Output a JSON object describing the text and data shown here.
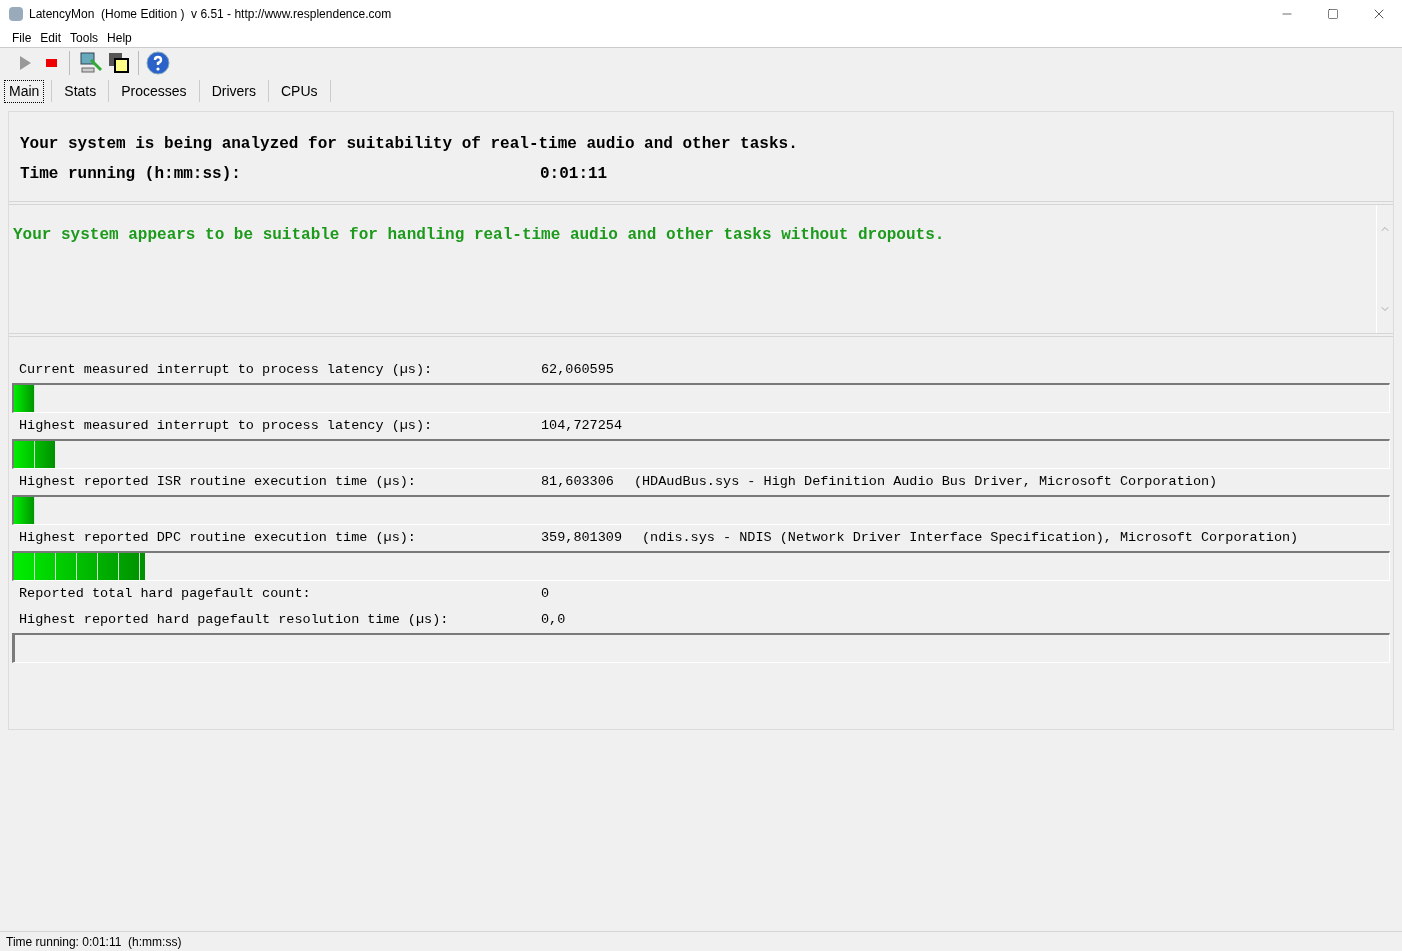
{
  "window": {
    "title": "LatencyMon  (Home Edition )  v 6.51 - http://www.resplendence.com"
  },
  "menu": [
    "File",
    "Edit",
    "Tools",
    "Help"
  ],
  "tabs": [
    {
      "label": "Main",
      "selected": true
    },
    {
      "label": "Stats",
      "selected": false
    },
    {
      "label": "Processes",
      "selected": false
    },
    {
      "label": "Drivers",
      "selected": false
    },
    {
      "label": "CPUs",
      "selected": false
    }
  ],
  "status_panel": {
    "message": "Your system is being analyzed for suitability of real-time audio and other tasks.",
    "time_label": "Time running (h:mm:ss):",
    "time_value": "0:01:11"
  },
  "verdict": "Your system appears to be suitable for handling real-time audio and other tasks without dropouts.",
  "measurements": [
    {
      "kind": "meter",
      "label": "Current measured interrupt to process latency (µs):",
      "value": "62,060595",
      "level": 0.015
    },
    {
      "kind": "meter",
      "label": "Highest measured interrupt to process latency (µs):",
      "value": "104,727254",
      "level": 0.03
    },
    {
      "kind": "meter",
      "label": "Highest reported ISR routine execution time (µs):",
      "value": "81,603306",
      "detail": "(HDAudBus.sys - High Definition Audio Bus Driver, Microsoft Corporation)",
      "level": 0.015
    },
    {
      "kind": "meter",
      "label": "Highest reported DPC routine execution time (µs):",
      "value": "359,801309",
      "detail": "(ndis.sys - NDIS (Network Driver Interface Specification), Microsoft Corporation)",
      "level": 0.095
    },
    {
      "kind": "plain",
      "label": "Reported total hard pagefault count:",
      "value": "0"
    },
    {
      "kind": "meter",
      "label": "Highest reported hard pagefault resolution time (µs):",
      "value": "0,0",
      "level": 0
    }
  ],
  "status_bar": "Time running: 0:01:11  (h:mm:ss)"
}
